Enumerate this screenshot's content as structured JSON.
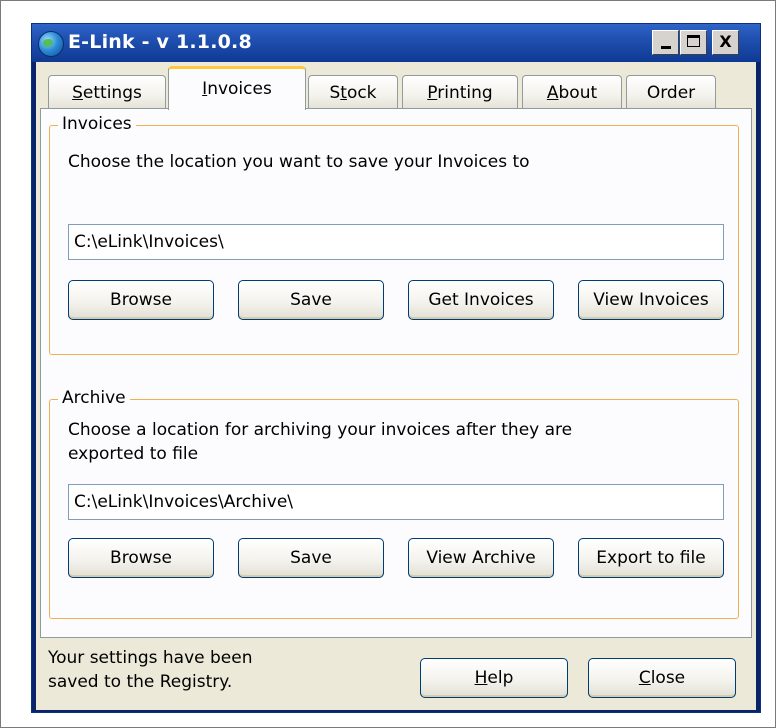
{
  "window": {
    "title": "E-Link - v 1.1.0.8",
    "controls": {
      "minimize": "_",
      "maximize": "□",
      "close": "X"
    }
  },
  "tabs": [
    {
      "label": "Settings",
      "accel": "S",
      "rest": "ettings",
      "active": false
    },
    {
      "label": "Invoices",
      "accel": "I",
      "rest": "nvoices",
      "active": true
    },
    {
      "label": "Stock",
      "accel_pre": "S",
      "accel": "t",
      "rest": "ock",
      "active": false
    },
    {
      "label": "Printing",
      "accel": "P",
      "rest": "rinting",
      "active": false
    },
    {
      "label": "About",
      "accel": "A",
      "rest": "bout",
      "active": false
    },
    {
      "label": "Order",
      "accel": "",
      "rest": "Order",
      "active": false
    }
  ],
  "invoices_group": {
    "legend": "Invoices",
    "description": "Choose the location you want to save your Invoices to",
    "path_value": "C:\\eLink\\Invoices\\",
    "buttons": [
      "Browse",
      "Save",
      "Get Invoices",
      "View Invoices"
    ]
  },
  "archive_group": {
    "legend": "Archive",
    "description_line1": "Choose a location for archiving your invoices after they are",
    "description_line2": "exported to file",
    "path_value": "C:\\eLink\\Invoices\\Archive\\",
    "buttons": [
      "Browse",
      "Save",
      "View Archive",
      "Export to file"
    ]
  },
  "status": {
    "line1": "Your settings have been",
    "line2": "saved to the Registry."
  },
  "footer_buttons": {
    "help": {
      "accel": "H",
      "rest": "elp"
    },
    "close": {
      "accel": "C",
      "rest": "lose"
    }
  },
  "colors": {
    "titlebar": "#1f4fb0",
    "dialog_bg": "#ece9d8",
    "group_border": "#f0b050",
    "tab_active_highlight": "#ffc83c"
  }
}
